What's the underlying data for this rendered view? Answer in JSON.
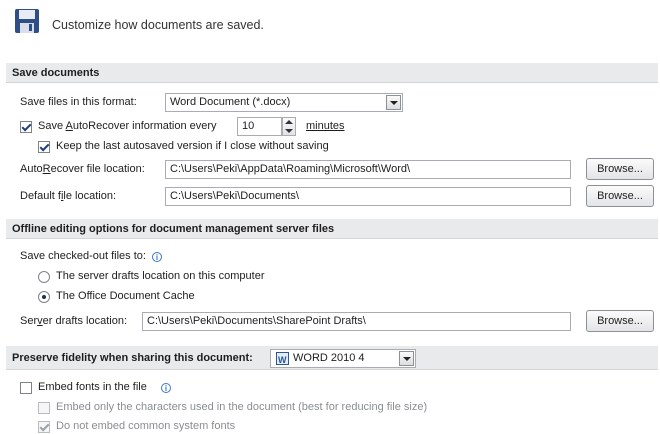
{
  "header": {
    "title": "Customize how documents are saved."
  },
  "save_documents": {
    "section_title": "Save documents",
    "format_label": "Save files in this format:",
    "format_value": "Word Document (*.docx)",
    "autorecover_label_pre": "Save ",
    "autorecover_label_u": "A",
    "autorecover_label_post": "utoRecover information every",
    "autorecover_minutes": "10",
    "minutes_label": "minutes",
    "keep_last_label": "Keep the last autosaved version if I close without saving",
    "autorecover_location_label_pre": "Auto",
    "autorecover_location_label_u": "R",
    "autorecover_location_label_post": "ecover file location:",
    "autorecover_location_value": "C:\\Users\\Peki\\AppData\\Roaming\\Microsoft\\Word\\",
    "default_location_label_pre": "Default f",
    "default_location_label_u": "i",
    "default_location_label_post": "le location:",
    "default_location_value": "C:\\Users\\Peki\\Documents\\",
    "browse_label": "Browse..."
  },
  "offline": {
    "section_title": "Offline editing options for document management server files",
    "save_checked_out_label": "Save checked-out files to:",
    "option_server_label": "The server drafts location on this computer",
    "option_cache_label": "The Office Document Cache",
    "server_drafts_label_pre": "Ser",
    "server_drafts_label_u": "v",
    "server_drafts_label_post": "er drafts location:",
    "server_drafts_value": "C:\\Users\\Peki\\Documents\\SharePoint Drafts\\",
    "browse_label": "Browse..."
  },
  "fidelity": {
    "section_title": "Preserve fidelity when sharing this document:",
    "document_value": "WORD 2010 4",
    "embed_fonts_label": "Embed fonts in the file",
    "embed_only_label": "Embed only the characters used in the document (best for reducing file size)",
    "do_not_embed_label": "Do not embed common system fonts"
  },
  "colors": {
    "section_bg": "#e9eaec",
    "accent": "#2b5797",
    "disabled_text": "#8a8d92"
  },
  "icons": [
    "floppy-disk-icon",
    "info-icon",
    "dropdown-arrow-icon",
    "word-document-icon",
    "spinner-arrows-icon"
  ]
}
